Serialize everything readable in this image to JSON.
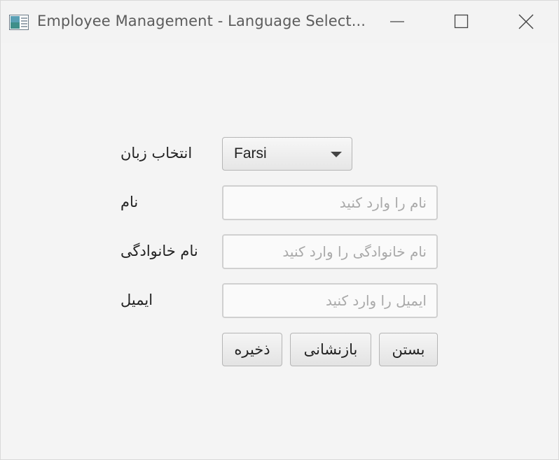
{
  "window": {
    "title": "Employee Management - Language Select..."
  },
  "form": {
    "language": {
      "label": "انتخاب زبان",
      "selected": "Farsi"
    },
    "first_name": {
      "label": "نام",
      "value": "",
      "placeholder": "نام را وارد کنید"
    },
    "last_name": {
      "label": "نام خانوادگی",
      "value": "",
      "placeholder": "نام خانوادگی را وارد کنید"
    },
    "email": {
      "label": "ایمیل",
      "value": "",
      "placeholder": "ایمیل را وارد کنید"
    }
  },
  "buttons": {
    "save": "ذخیره",
    "reset": "بازنشانی",
    "close": "بستن"
  },
  "icons": {
    "app": "app-window-icon",
    "minimize": "minimize-icon",
    "maximize": "maximize-icon",
    "close": "close-icon",
    "dropdown": "chevron-down-icon"
  }
}
